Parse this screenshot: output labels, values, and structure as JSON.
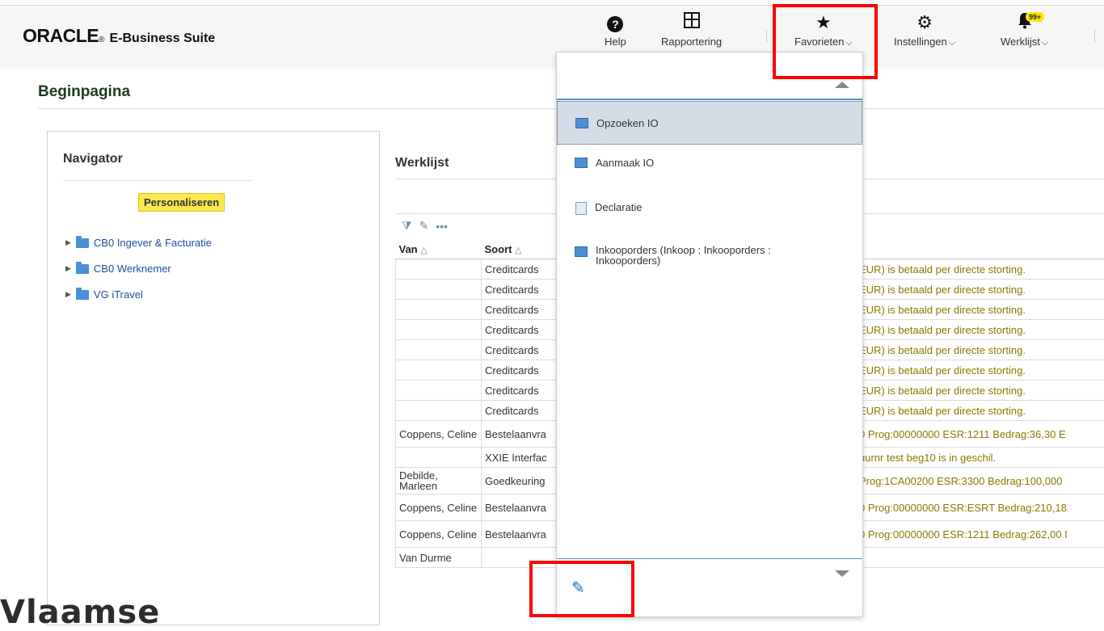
{
  "app": {
    "logo_oracle": "ORACLE",
    "logo_product": "E-Business Suite"
  },
  "header": {
    "help": "Help",
    "reporting": "Rapportering",
    "favorites": "Favorieten",
    "settings": "Instellingen",
    "worklist": "Werklijst",
    "worklist_badge": "99+"
  },
  "page": {
    "title": "Beginpagina"
  },
  "navigator": {
    "title": "Navigator",
    "personalize": "Personaliseren",
    "items": [
      "CB0 Ingever & Facturatie",
      "CB0 Werknemer",
      "VG iTravel"
    ]
  },
  "worklist": {
    "title": "Werklijst",
    "columns": [
      "Van",
      "Soort"
    ],
    "rows": [
      {
        "from": "",
        "type": "Creditcards",
        "msg": "EUR) is betaald per directe storting."
      },
      {
        "from": "",
        "type": "Creditcards",
        "msg": "EUR) is betaald per directe storting."
      },
      {
        "from": "",
        "type": "Creditcards",
        "msg": "EUR) is betaald per directe storting."
      },
      {
        "from": "",
        "type": "Creditcards",
        "msg": "EUR) is betaald per directe storting."
      },
      {
        "from": "",
        "type": "Creditcards",
        "msg": "EUR) is betaald per directe storting."
      },
      {
        "from": "",
        "type": "Creditcards",
        "msg": "EUR) is betaald per directe storting."
      },
      {
        "from": "",
        "type": "Creditcards",
        "msg": "EUR) is betaald per directe storting."
      },
      {
        "from": "",
        "type": "Creditcards",
        "msg": "EUR) is betaald per directe storting."
      },
      {
        "from": "Coppens, Celine",
        "type": "Bestelaanvra",
        "msg": "0 Prog:00000000 ESR:1211 Bedrag:36,30 E"
      },
      {
        "from": "",
        "type": "XXIE Interfac",
        "msg": "uurnr test beg10 is in geschil."
      },
      {
        "from": "Debilde, Marleen",
        "type": "Goedkeuring",
        "msg": "Prog:1CA00200 ESR:3300 Bedrag:100,000"
      },
      {
        "from": "Coppens, Celine",
        "type": "Bestelaanvra",
        "msg": "0 Prog:00000000 ESR:ESRT Bedrag:210,18"
      },
      {
        "from": "Coppens, Celine",
        "type": "Bestelaanvra",
        "msg": "0 Prog:00000000 ESR:1211 Bedrag:262,00 I"
      },
      {
        "from": "Van Durme",
        "type": "",
        "msg": ""
      }
    ]
  },
  "favorites_menu": {
    "items": [
      {
        "label": "Opzoeken IO",
        "icon": "form-icon"
      },
      {
        "label": "Aanmaak IO",
        "icon": "form-icon"
      },
      {
        "label": "Declaratie",
        "icon": "document-icon"
      },
      {
        "label": "Inkooporders (Inkoop : Inkooporders : Inkooporders)",
        "icon": "form-icon"
      }
    ]
  },
  "watermark": "Vlaamse",
  "colors": {
    "highlight": "#ff0000",
    "accent": "#1f67c2",
    "personalize_bg": "#fbe84f"
  }
}
